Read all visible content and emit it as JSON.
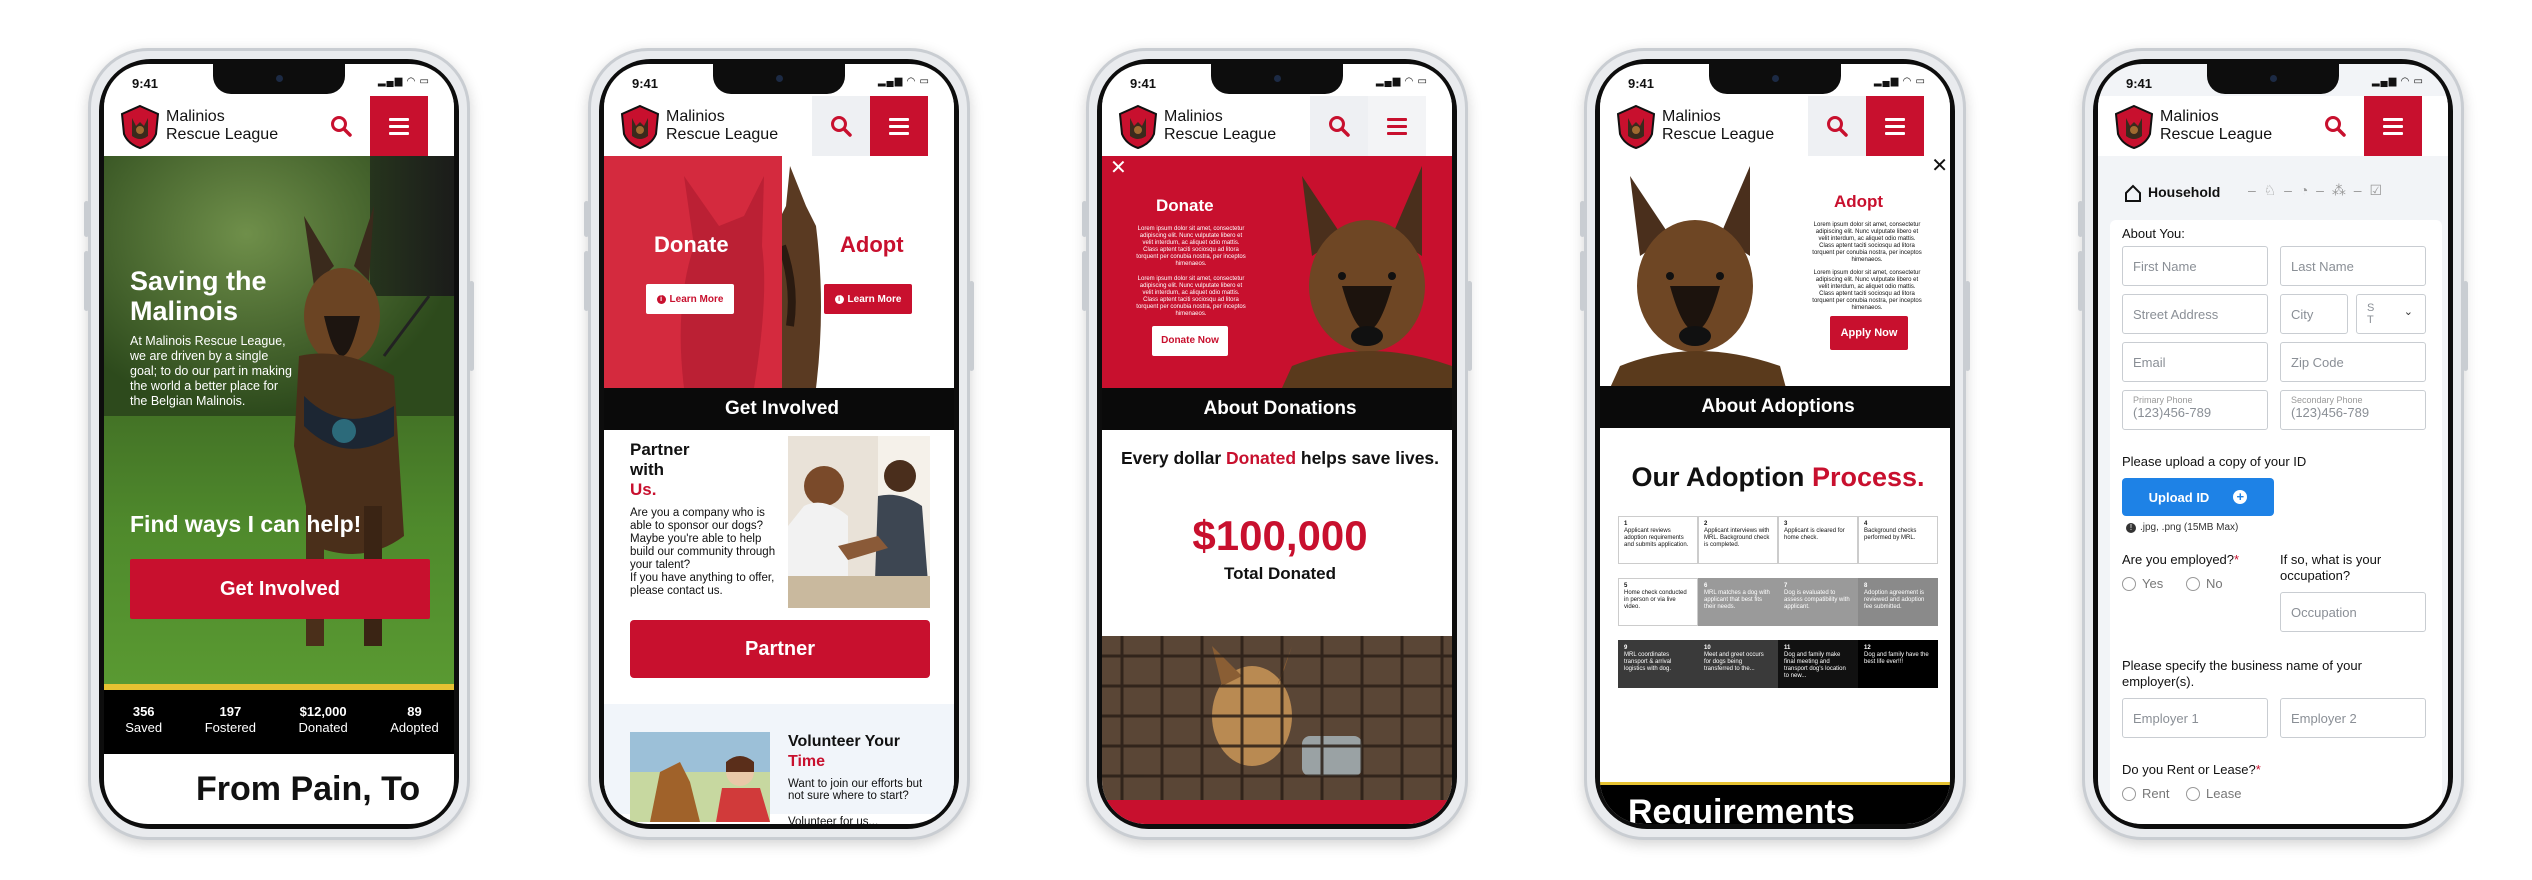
{
  "status_time": "9:41",
  "brand": {
    "line1": "Malinios",
    "line2": "Rescue League"
  },
  "colors": {
    "accent": "#c8102e",
    "dark": "#0a0a0a",
    "blue": "#1e82e6"
  },
  "p1": {
    "hero_title_1": "Saving the",
    "hero_title_2": "Malinois",
    "hero_text": "At Malinois Rescue League, we are driven by a single goal; to do our part in making the world a better place for the Belgian Malinois.",
    "find_ways": "Find ways I can help!",
    "cta": "Get Involved",
    "stats": [
      {
        "num": "356",
        "label": "Saved"
      },
      {
        "num": "197",
        "label": "Fostered"
      },
      {
        "num": "$12,000",
        "label": "Donated"
      },
      {
        "num": "89",
        "label": "Adopted"
      }
    ],
    "peek": "From Pain, To"
  },
  "p2": {
    "donate": "Donate",
    "adopt": "Adopt",
    "learn_more": "Learn More",
    "bar": "Get Involved",
    "partner_title_1": "Partner",
    "partner_title_2": "with",
    "partner_title_3": "Us.",
    "partner_text": "Are you a company who is able to sponsor our dogs? Maybe you're able to help build our community through your talent?",
    "partner_text2": "If you have anything to offer, please contact us.",
    "partner_btn": "Partner",
    "vol_title_1": "Volunteer Your",
    "vol_title_2": "Time",
    "vol_text": "Want to join our efforts but not sure where to start?",
    "vol_text2": "Volunteer for us..."
  },
  "p3": {
    "donate": "Donate",
    "lorem1": "Lorem ipsum dolor sit amet, consectetur adipiscing elit. Nunc vulputate libero et velit interdum, ac aliquet odio mattis. Class aptent taciti sociosqu ad litora torquent per conubia nostra, per inceptos himenaeos.",
    "lorem2": "Lorem ipsum dolor sit amet, consectetur adipiscing elit. Nunc vulputate libero et velit interdum, ac aliquet odio mattis. Class aptent taciti sociosqu ad litora torquent per conubia nostra, per inceptos himenaeos.",
    "donate_now": "Donate Now",
    "bar": "About Donations",
    "every_1": "Every dollar ",
    "every_2": "Donated",
    "every_3": " helps save lives.",
    "amount": "$100,000",
    "amount_label": "Total Donated"
  },
  "p4": {
    "adopt": "Adopt",
    "lorem1": "Lorem ipsum dolor sit amet, consectetur adipiscing elit. Nunc vulputate libero et velit interdum, ac aliquet odio mattis. Class aptent taciti sociosqu ad litora torquent per conubia nostra, per inceptos himenaeos.",
    "lorem2": "Lorem ipsum dolor sit amet, consectetur adipiscing elit. Nunc vulputate libero et velit interdum, ac aliquet odio mattis. Class aptent taciti sociosqu ad litora torquent per conubia nostra, per inceptos himenaeos.",
    "apply": "Apply Now",
    "bar": "About Adoptions",
    "process_1": "Our Adoption ",
    "process_2": "Process.",
    "steps": [
      {
        "n": "1",
        "t": "Applicant reviews adoption requirements and submits application."
      },
      {
        "n": "2",
        "t": "Applicant interviews with MRL. Background check is completed."
      },
      {
        "n": "3",
        "t": "Applicant is cleared for home check."
      },
      {
        "n": "4",
        "t": "Background checks performed by MRL."
      },
      {
        "n": "5",
        "t": "Home check conducted in person or via live video."
      },
      {
        "n": "6",
        "t": "MRL matches a dog with applicant that best fits their needs."
      },
      {
        "n": "7",
        "t": "Dog is evaluated to assess compatibility with applicant."
      },
      {
        "n": "8",
        "t": "Adoption agreement is reviewed and adoption fee submitted."
      },
      {
        "n": "9",
        "t": "MRL coordinates transport & arrival logistics with dog."
      },
      {
        "n": "10",
        "t": "Meet and greet occurs for dogs being transferred to the..."
      },
      {
        "n": "11",
        "t": "Dog and family make final meeting and transport dog's location to new..."
      },
      {
        "n": "12",
        "t": "Dog and family have the best life ever!!!"
      }
    ],
    "peek": "Requirements"
  },
  "p5": {
    "step_title": "Household",
    "about": "About You:",
    "first": "First Name",
    "last": "Last Name",
    "street": "Street Address",
    "city": "City",
    "state": "S T",
    "email": "Email",
    "zip": "Zip Code",
    "primary_label": "Primary Phone",
    "primary": "(123)456-789",
    "secondary_label": "Secondary Phone",
    "secondary": "(123)456-789",
    "upload_q": "Please upload a copy of your ID",
    "upload_btn": "Upload ID",
    "upload_note": ".jpg, .png (15MB Max)",
    "employed_q": "Are you employed?",
    "yes": "Yes",
    "no": "No",
    "occ_q": "If so, what is your occupation?",
    "occ": "Occupation",
    "biz_q": "Please specify the business name of your employer(s).",
    "emp1": "Employer 1",
    "emp2": "Employer 2",
    "rent_q": "Do you Rent or Lease?",
    "rent": "Rent",
    "lease": "Lease"
  }
}
